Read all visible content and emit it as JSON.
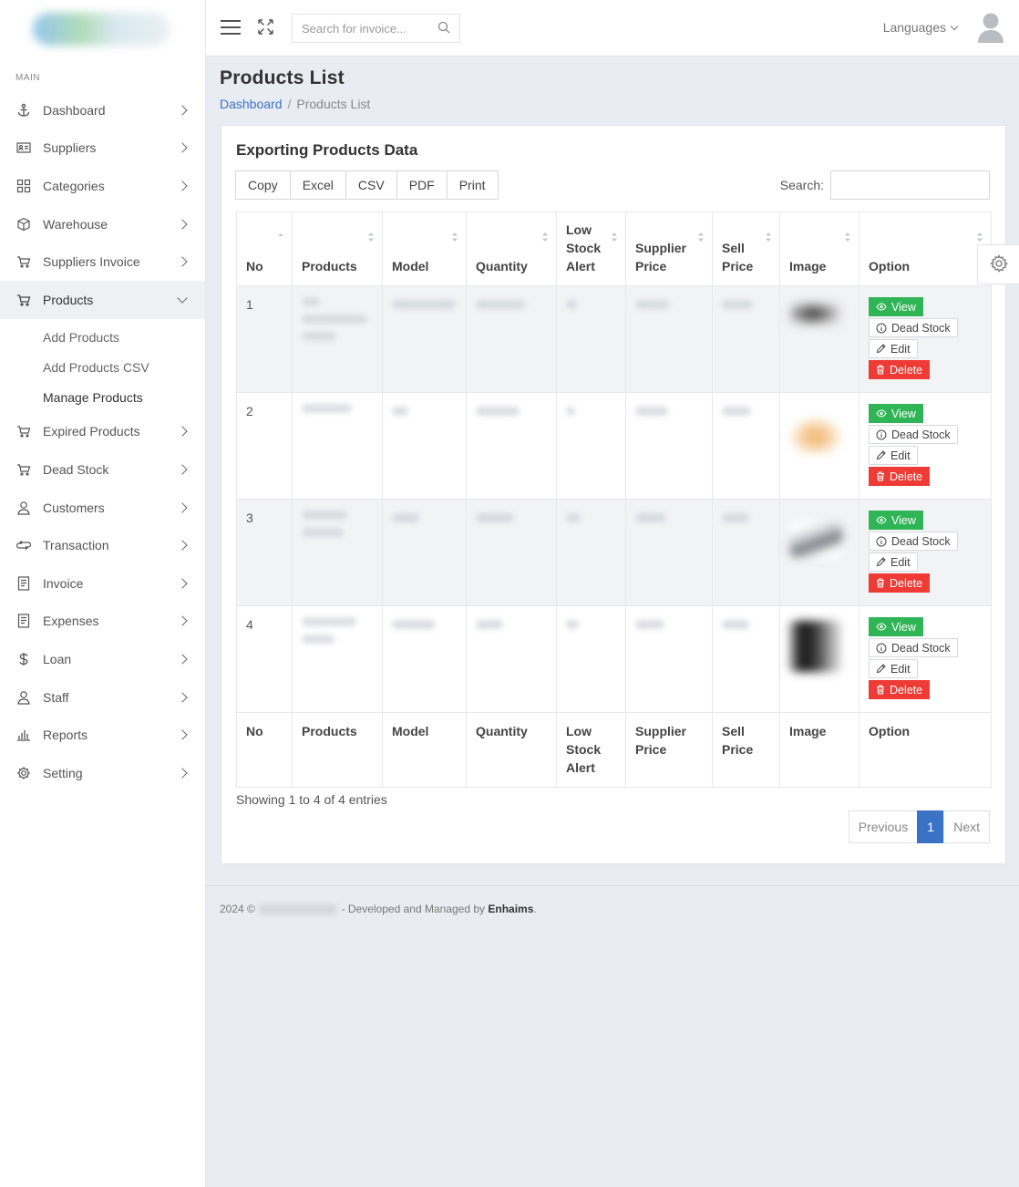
{
  "sidebar": {
    "section_label": "MAIN",
    "items": [
      {
        "label": "Dashboard",
        "icon": "anchor-icon"
      },
      {
        "label": "Suppliers",
        "icon": "id-card-icon"
      },
      {
        "label": "Categories",
        "icon": "grid-icon"
      },
      {
        "label": "Warehouse",
        "icon": "box-icon"
      },
      {
        "label": "Suppliers Invoice",
        "icon": "cart-icon"
      },
      {
        "label": "Products",
        "icon": "cart-icon"
      },
      {
        "label": "Expired Products",
        "icon": "cart-icon"
      },
      {
        "label": "Dead Stock",
        "icon": "cart-icon"
      },
      {
        "label": "Customers",
        "icon": "user-icon"
      },
      {
        "label": "Transaction",
        "icon": "exchange-icon"
      },
      {
        "label": "Invoice",
        "icon": "document-icon"
      },
      {
        "label": "Expenses",
        "icon": "document-icon"
      },
      {
        "label": "Loan",
        "icon": "dollar-icon"
      },
      {
        "label": "Staff",
        "icon": "user-icon"
      },
      {
        "label": "Reports",
        "icon": "bar-chart-icon"
      },
      {
        "label": "Setting",
        "icon": "gear-icon"
      }
    ],
    "products_submenu": [
      "Add Products",
      "Add Products CSV",
      "Manage Products"
    ]
  },
  "header": {
    "search_placeholder": "Search for invoice...",
    "languages_label": "Languages"
  },
  "page": {
    "title": "Products List",
    "breadcrumb_home": "Dashboard",
    "breadcrumb_current": "Products List"
  },
  "card": {
    "title": "Exporting Products Data",
    "export_buttons": [
      "Copy",
      "Excel",
      "CSV",
      "PDF",
      "Print"
    ],
    "search_label": "Search:"
  },
  "table": {
    "columns": [
      "No",
      "Products",
      "Model",
      "Quantity",
      "Low Stock Alert",
      "Supplier Price",
      "Sell Price",
      "Image",
      "Option"
    ],
    "rows": [
      {
        "no": "1"
      },
      {
        "no": "2"
      },
      {
        "no": "3"
      },
      {
        "no": "4"
      }
    ],
    "option_labels": {
      "view": "View",
      "dead": "Dead Stock",
      "edit": "Edit",
      "delete": "Delete"
    }
  },
  "pagination": {
    "info": "Showing 1 to 4 of 4 entries",
    "previous": "Previous",
    "current": "1",
    "next": "Next"
  },
  "footer": {
    "year": "2024 ©",
    "text": "- Developed and Managed by",
    "company": "Enhaims",
    "end": "."
  },
  "colors": {
    "primary": "#3a72c6",
    "view": "#2fb556",
    "delete": "#ee3b35"
  }
}
